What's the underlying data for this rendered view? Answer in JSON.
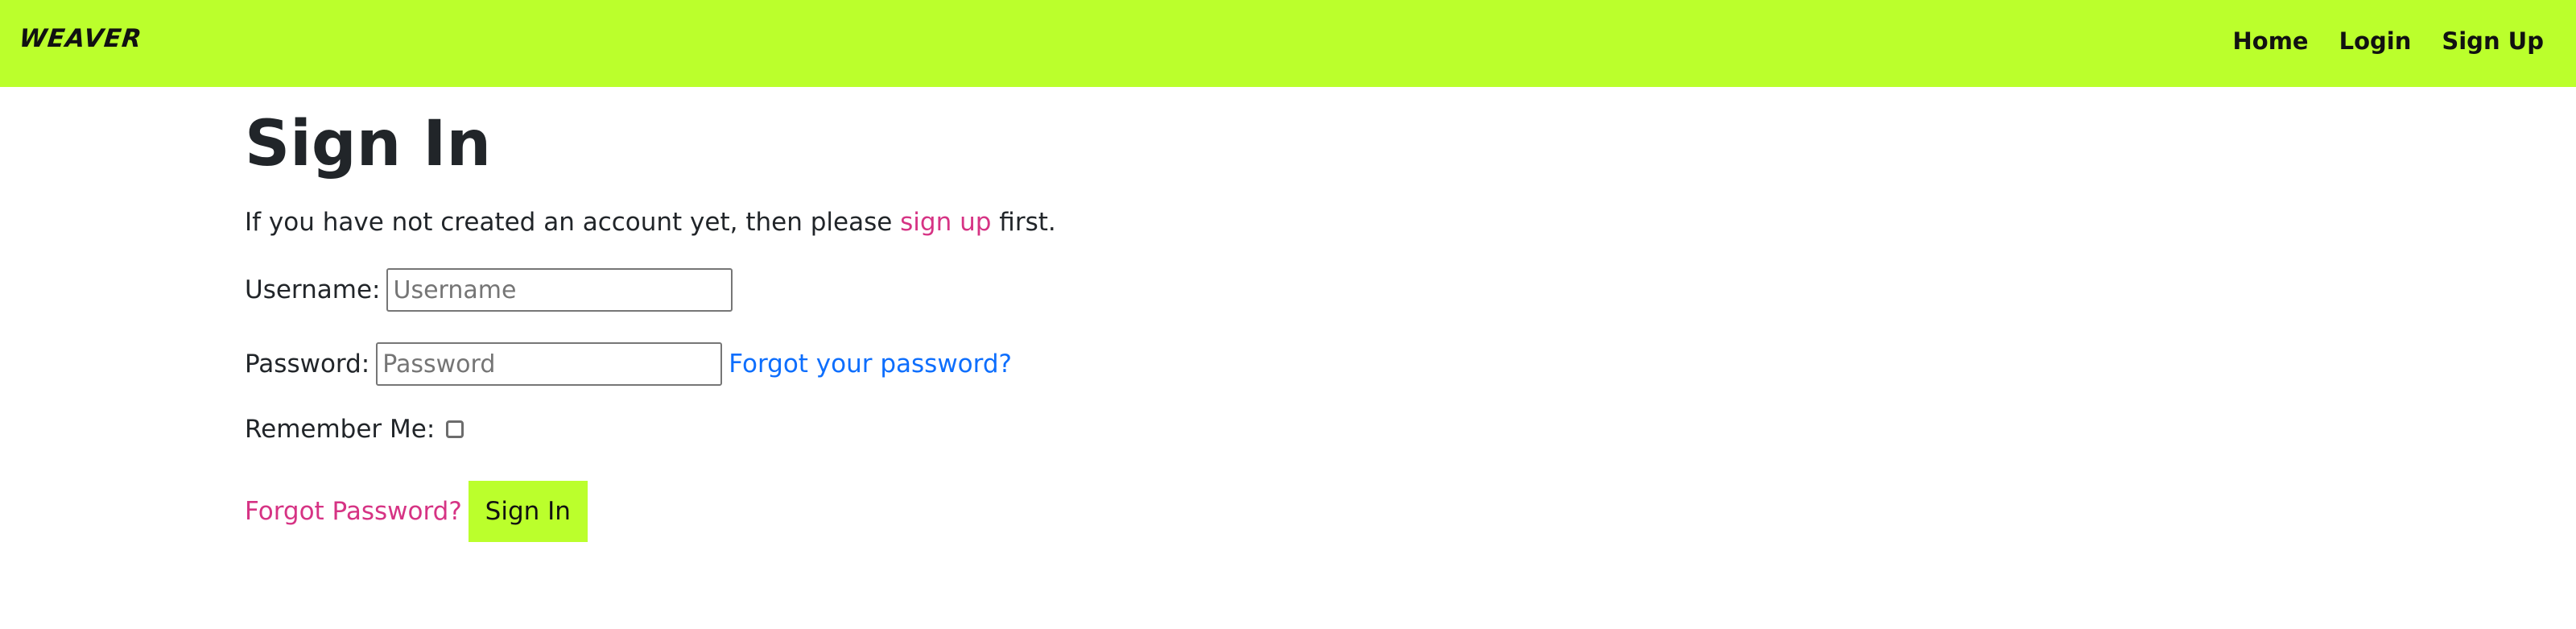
{
  "navbar": {
    "brand": "WEAVER",
    "links": [
      "Home",
      "Login",
      "Sign Up"
    ],
    "accent_color": "#bbff2c"
  },
  "page": {
    "title": "Sign In",
    "intro_before": "If you have not created an account yet, then please ",
    "intro_link": "sign up",
    "intro_after": " first."
  },
  "form": {
    "username_label": "Username:",
    "username_placeholder": "Username",
    "username_value": "",
    "password_label": "Password:",
    "password_placeholder": "Password",
    "password_value": "",
    "forgot_inline_link": "Forgot your password?",
    "remember_label": "Remember Me:",
    "remember_checked": false,
    "forgot_link": "Forgot Password?",
    "submit_label": "Sign In"
  }
}
